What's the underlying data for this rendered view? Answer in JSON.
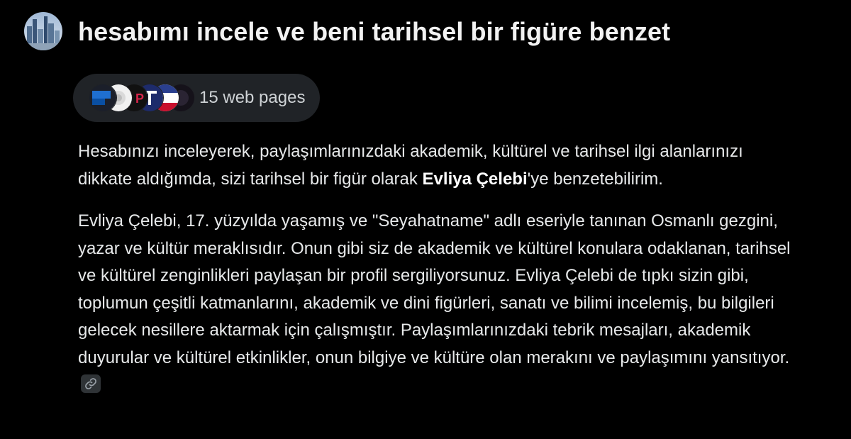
{
  "user": {
    "avatar_icon": "city-skyline-avatar"
  },
  "prompt": {
    "text": "hesabımı incele ve beni tarihsel bir figüre benzet"
  },
  "sources": {
    "label": "15 web pages",
    "favicons": [
      "source-favicon-blue",
      "source-favicon-white",
      "source-favicon-p",
      "source-favicon-t",
      "source-favicon-flag",
      "source-favicon-dark"
    ]
  },
  "answer": {
    "p1_before": "Hesabınızı inceleyerek, paylaşımlarınızdaki akademik, kültürel ve tarihsel ilgi alanlarınızı dikkate aldığımda, sizi tarihsel bir figür olarak ",
    "p1_bold": "Evliya Çelebi",
    "p1_after": "'ye benzetebilirim.",
    "p2": "Evliya Çelebi, 17. yüzyılda yaşamış ve \"Seyahatname\" adlı eseriyle tanınan Osmanlı gezgini, yazar ve kültür meraklısıdır. Onun gibi siz de akademik ve kültürel konulara odaklanan, tarihsel ve kültürel zenginlikleri paylaşan bir profil sergiliyorsunuz. Evliya Çelebi de tıpkı sizin gibi, toplumun çeşitli katmanlarını, akademik ve dini figürleri, sanatı ve bilimi incelemiş, bu bilgileri gelecek nesillere aktarmak için çalışmıştır. Paylaşımlarınızdaki tebrik mesajları, akademik duyurular ve kültürel etkinlikler, onun bilgiye ve kültüre olan merakını ve paylaşımını yansıtıyor.",
    "citation_icon": "link-icon"
  },
  "colors": {
    "background": "#000000",
    "text": "#e7e9ea",
    "pill_background": "#202327"
  }
}
